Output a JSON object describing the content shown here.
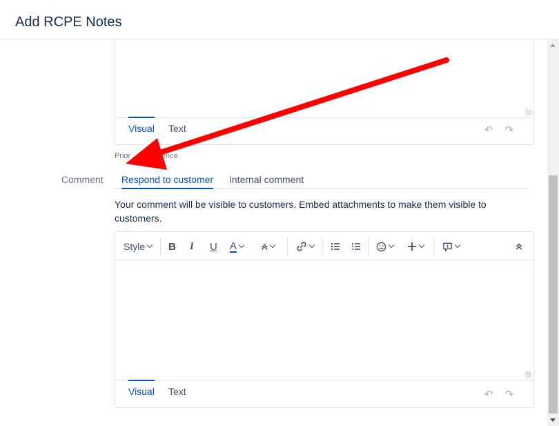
{
  "dialog": {
    "title": "Add RCPE Notes"
  },
  "upper_editor": {
    "tabs": {
      "visual": "Visual",
      "text": "Text"
    },
    "undo_glyph": "↶",
    "redo_glyph": "↷"
  },
  "helper_text": "Prior ... r reference.",
  "comment": {
    "label": "Comment",
    "tabs": {
      "respond": "Respond to customer",
      "internal": "Internal comment"
    },
    "visibility_note": "Your comment will be visible to customers. Embed attachments to make them visible to customers."
  },
  "toolbar": {
    "style_label": "Style",
    "bold": "B",
    "italic": "I",
    "underline": "U",
    "text_color": "A",
    "more_formatting": "A",
    "icons": [
      "chevron-down-icon",
      "link-icon",
      "bullet-list-icon",
      "numbered-list-icon",
      "emoji-icon",
      "plus-icon",
      "status-icon",
      "collapse-icon"
    ]
  },
  "main_editor": {
    "tabs": {
      "visual": "Visual",
      "text": "Text"
    },
    "undo_glyph": "↶",
    "redo_glyph": "↷"
  },
  "colors": {
    "accent": "#0052cc",
    "annotation_arrow": "#ff0000"
  }
}
